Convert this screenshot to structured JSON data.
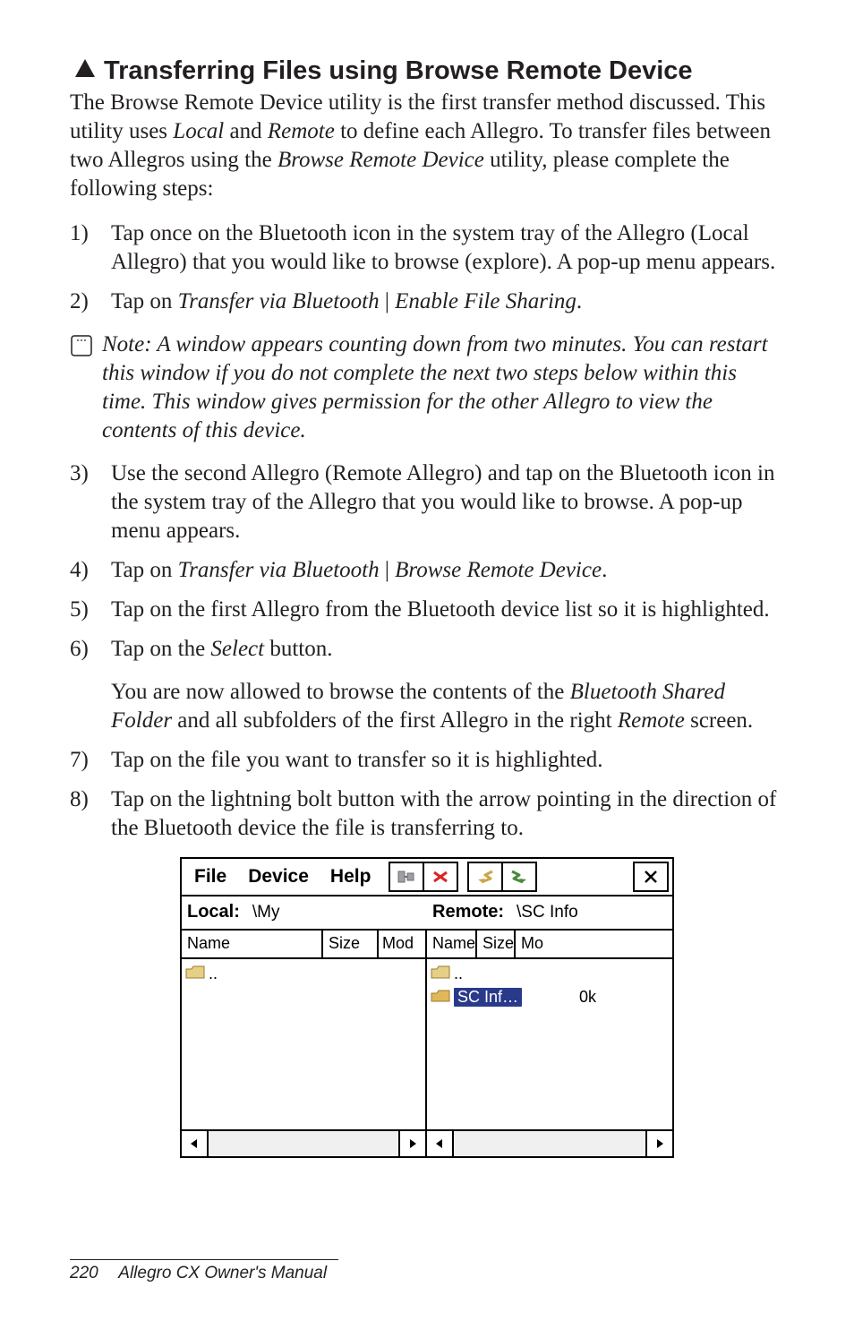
{
  "heading": "Transferring Files using Browse Remote Device",
  "intro": "The Browse Remote Device utility is the first transfer method discussed. This utility uses Local and Remote to define each Allegro. To transfer files between two Allegros using the Browse Remote Device utility, please complete the following steps:",
  "steps": {
    "s1": {
      "marker": "1)",
      "text": "Tap once on the Bluetooth icon in the system tray of the Allegro (Local Allegro) that you would like to browse (explore). A pop-up menu appears."
    },
    "s2": {
      "marker": "2)",
      "prefix": "Tap on ",
      "i1": "Transfer via Bluetooth",
      "mid": " | ",
      "i2": "Enable File Sharing",
      "suffix": "."
    },
    "note": "Note: A window appears counting down from two minutes. You can restart this window if you do not complete the next two steps below within this time. This window gives permission for the other Allegro to view the contents of this device.",
    "s3": {
      "marker": "3)",
      "text": "Use the second Allegro (Remote Allegro) and tap on the Bluetooth icon in the system tray of the Allegro that you would like to browse. A pop-up menu appears."
    },
    "s4": {
      "marker": "4)",
      "prefix": "Tap on ",
      "i1": "Transfer via Bluetooth",
      "mid": " | ",
      "i2": "Browse Remote Device",
      "suffix": "."
    },
    "s5": {
      "marker": "5)",
      "text": "Tap on the first Allegro from the Bluetooth device list so it is highlighted."
    },
    "s6": {
      "marker": "6)",
      "prefix": "Tap on the ",
      "i1": "Select",
      "suffix": " button."
    },
    "s6b": {
      "pre": "You are now allowed to browse the contents of the ",
      "i1": "Bluetooth Shared Folder",
      "mid": " and all subfolders of the first Allegro in the right ",
      "i2": "Remote",
      "suffix": " screen."
    },
    "s7": {
      "marker": "7)",
      "text": "Tap on the file you want to transfer so it is highlighted."
    },
    "s8": {
      "marker": "8)",
      "text": "Tap on the lightning bolt button with the arrow pointing in the direction of the Bluetooth device the file is transferring to."
    }
  },
  "shot": {
    "menus": {
      "file": "File",
      "device": "Device",
      "help": "Help"
    },
    "local_label": "Local:",
    "local_path": "\\My",
    "remote_label": "Remote:",
    "remote_path": "\\SC Info",
    "cols": {
      "name": "Name",
      "size": "Size",
      "mod_l": "Mod",
      "mod_r": "Mo"
    },
    "left_rows": {
      "up": ".."
    },
    "right_rows": {
      "up": "..",
      "r1_name": "SC Inf…",
      "r1_size": "0k"
    }
  },
  "footer": {
    "page": "220",
    "title": "Allegro CX Owner's Manual"
  }
}
